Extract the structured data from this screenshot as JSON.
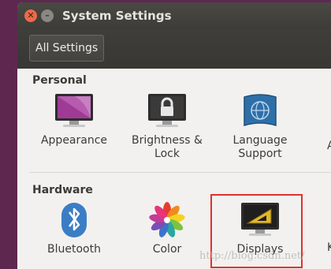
{
  "window": {
    "title": "System Settings"
  },
  "toolbar": {
    "all_settings_label": "All Settings"
  },
  "sections": {
    "personal": {
      "title": "Personal",
      "items": [
        {
          "label_line1": "Appearance",
          "label_line2": "",
          "icon": "appearance-icon"
        },
        {
          "label_line1": "Brightness &",
          "label_line2": "Lock",
          "icon": "brightness-lock-icon"
        },
        {
          "label_line1": "Language",
          "label_line2": "Support",
          "icon": "language-support-icon"
        }
      ],
      "partial_next": "A"
    },
    "hardware": {
      "title": "Hardware",
      "items": [
        {
          "label": "Bluetooth",
          "icon": "bluetooth-icon"
        },
        {
          "label": "Color",
          "icon": "color-icon"
        },
        {
          "label": "Displays",
          "icon": "displays-icon"
        }
      ],
      "partial_next": "K"
    }
  },
  "watermark": "http://blog.csdn.net/",
  "colors": {
    "accent_purple": "#5e2750",
    "highlight_red": "#e0312f"
  }
}
